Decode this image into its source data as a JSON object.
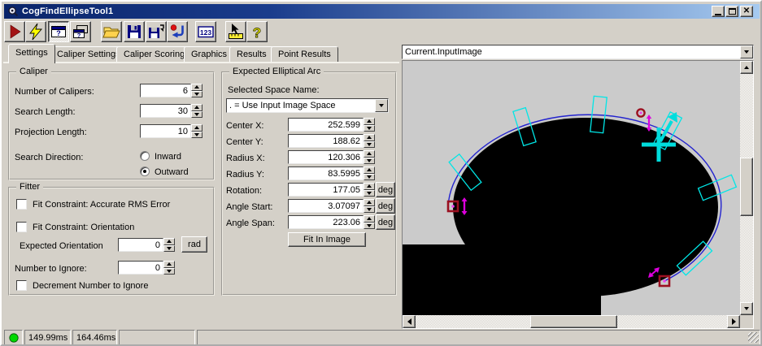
{
  "window": {
    "title": "CogFindEllipseTool1"
  },
  "toolbar": {
    "numbers_label": "123",
    "question_glyph": "?",
    "buttons": [
      {
        "name": "run-button",
        "icon": "run-icon"
      },
      {
        "name": "live-run-button",
        "icon": "lightning-icon"
      },
      {
        "name": "tool-display-button",
        "icon": "window-question-icon",
        "pressed": true
      },
      {
        "name": "float-display-button",
        "icon": "windows-question-icon",
        "pressed": false
      },
      {
        "name": "open-button",
        "icon": "open-folder-icon"
      },
      {
        "name": "save-button",
        "icon": "floppy-icon"
      },
      {
        "name": "save-as-button",
        "icon": "floppy-arrow-icon"
      },
      {
        "name": "reset-button",
        "icon": "reset-arrow-icon"
      },
      {
        "name": "numeric-results-button",
        "icon": "numbers-123-icon"
      },
      {
        "name": "measure-button",
        "icon": "ruler-cursor-icon"
      },
      {
        "name": "help-button",
        "icon": "question-mark-icon"
      }
    ]
  },
  "tabs": {
    "selected": "Settings",
    "items": [
      {
        "label": "Settings"
      },
      {
        "label": "Caliper Settings"
      },
      {
        "label": "Caliper Scoring"
      },
      {
        "label": "Graphics"
      },
      {
        "label": "Results"
      },
      {
        "label": "Point Results"
      }
    ]
  },
  "panels": {
    "caliper": {
      "title": "Caliper",
      "number_of_calipers": {
        "label": "Number of Calipers:",
        "value": "6"
      },
      "search_length": {
        "label": "Search Length:",
        "value": "30"
      },
      "projection_length": {
        "label": "Projection Length:",
        "value": "10"
      },
      "search_direction": {
        "label": "Search Direction:",
        "options": [
          {
            "label": "Inward",
            "selected": false
          },
          {
            "label": "Outward",
            "selected": true
          }
        ]
      }
    },
    "fitter": {
      "title": "Fitter",
      "fit_rms": {
        "label": "Fit Constraint: Accurate RMS Error",
        "checked": false
      },
      "fit_orientation": {
        "label": "Fit Constraint: Orientation",
        "checked": false
      },
      "expected_orientation": {
        "label": "Expected Orientation",
        "value": "0",
        "unit": "rad"
      },
      "number_to_ignore": {
        "label": "Number to Ignore:",
        "value": "0"
      },
      "decrement": {
        "label": "Decrement Number to Ignore",
        "checked": false
      }
    },
    "arc": {
      "title": "Expected Elliptical Arc",
      "selected_space": {
        "label": "Selected Space Name:",
        "value": ". = Use Input Image Space"
      },
      "rows": {
        "center_x": {
          "label": "Center X:",
          "value": "252.599"
        },
        "center_y": {
          "label": "Center Y:",
          "value": "188.62"
        },
        "radius_x": {
          "label": "Radius X:",
          "value": "120.306"
        },
        "radius_y": {
          "label": "Radius Y:",
          "value": "83.5995"
        },
        "rotation": {
          "label": "Rotation:",
          "value": "177.05",
          "unit": "deg"
        },
        "angle_start": {
          "label": "Angle Start:",
          "value": "3.07097",
          "unit": "deg"
        },
        "angle_span": {
          "label": "Angle Span:",
          "value": "223.06",
          "unit": "deg"
        }
      },
      "fit_button": "Fit In Image"
    }
  },
  "display": {
    "image_selector": "Current.InputImage",
    "colors": {
      "background": "#cbcbcb",
      "blob": "#000000",
      "arc_line": "#2323cf",
      "caliper": "#00e6e6",
      "marker": "#dd00dd",
      "handle": "#00dddd",
      "anchor": "#9b1020"
    }
  },
  "statusbar": {
    "indicator_color": "#00d800",
    "time1": "149.99ms",
    "time2": "164.46ms"
  }
}
